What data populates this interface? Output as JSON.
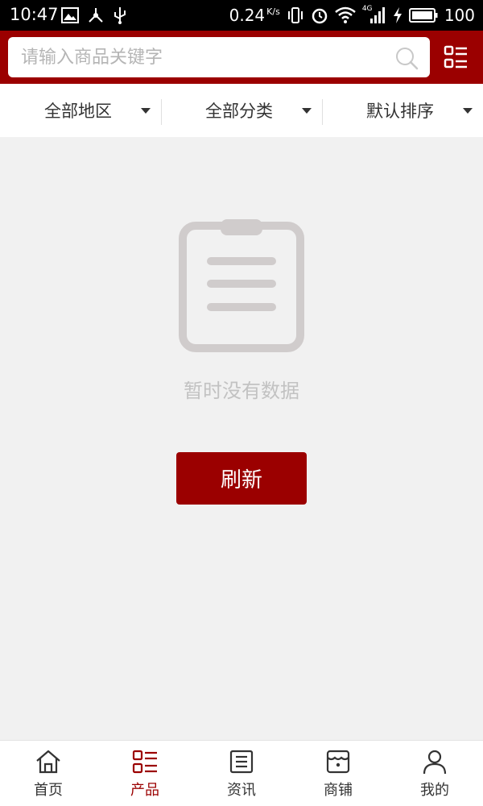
{
  "status_bar": {
    "time": "10:47",
    "network_speed": "0.24",
    "speed_unit": "K/s",
    "signal_type": "4G",
    "battery": "100"
  },
  "header": {
    "search_placeholder": "请输入商品关键字"
  },
  "filters": [
    {
      "label": "全部地区"
    },
    {
      "label": "全部分类"
    },
    {
      "label": "默认排序"
    }
  ],
  "empty_state": {
    "message": "暂时没有数据",
    "refresh_label": "刷新"
  },
  "bottom_nav": {
    "active_index": 1,
    "items": [
      {
        "label": "首页",
        "icon": "home-icon"
      },
      {
        "label": "产品",
        "icon": "product-list-icon"
      },
      {
        "label": "资讯",
        "icon": "news-icon"
      },
      {
        "label": "商铺",
        "icon": "store-icon"
      },
      {
        "label": "我的",
        "icon": "user-icon"
      }
    ]
  },
  "colors": {
    "brand": "#9b0000",
    "background": "#f1f1f1",
    "empty_text": "#c2c2c2",
    "text": "#333333"
  }
}
